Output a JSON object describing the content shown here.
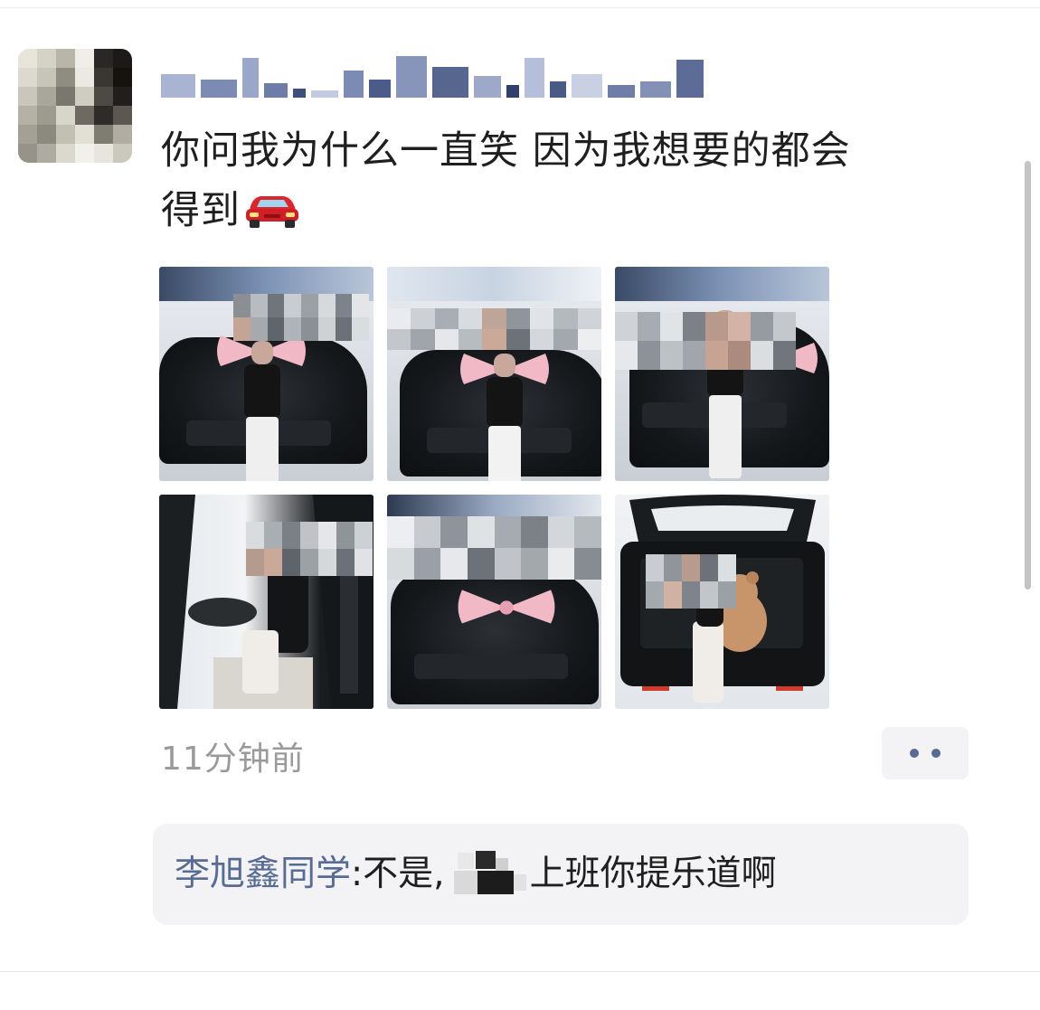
{
  "post": {
    "author_name": "",
    "text_line1": "你问我为什么一直笑 因为我想要的都会",
    "text_line2": "得到",
    "emoji": "car-emoji",
    "photos": [
      {
        "label": "photo-1"
      },
      {
        "label": "photo-2"
      },
      {
        "label": "photo-3"
      },
      {
        "label": "photo-4"
      },
      {
        "label": "photo-5"
      },
      {
        "label": "photo-6"
      }
    ],
    "time": "11分钟前",
    "more_icon": "more-dots-icon"
  },
  "comment": {
    "author": "李旭鑫同学",
    "separator": ":",
    "text_before": " 不是,",
    "text_after": "上班你提乐道啊"
  },
  "colors": {
    "link_blue": "#576b95",
    "text": "#1f1f1f",
    "timestamp": "#9a9a9a",
    "comment_bg": "#f3f3f5"
  }
}
